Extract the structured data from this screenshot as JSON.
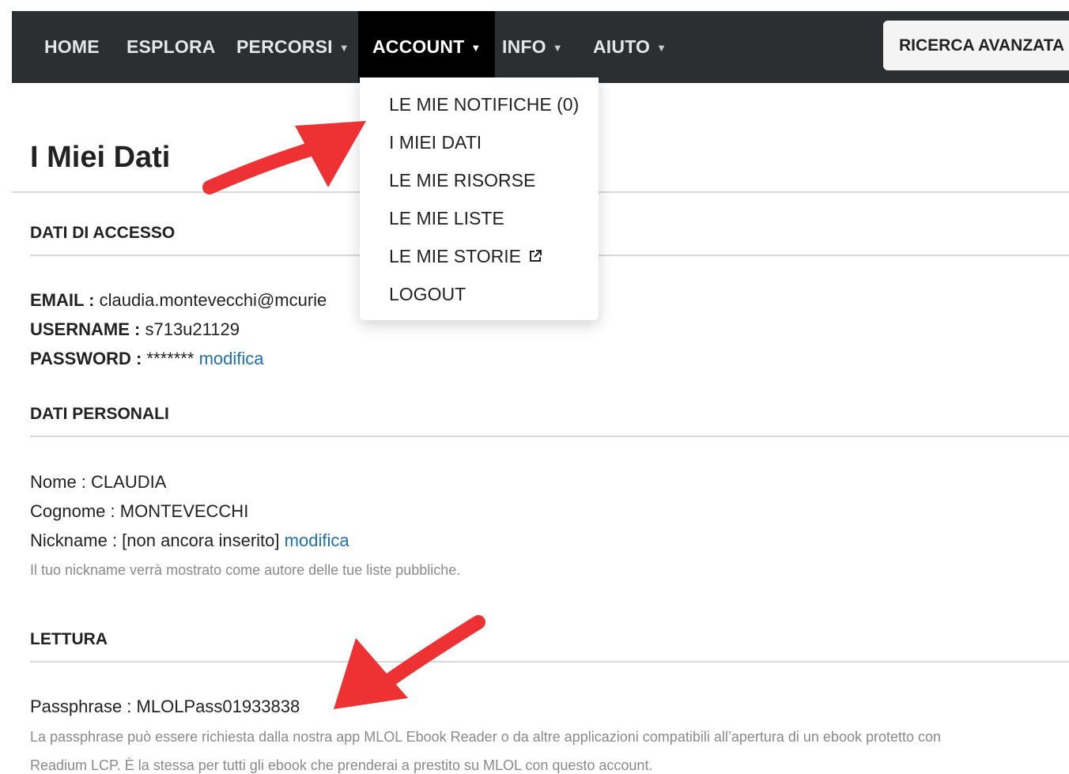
{
  "nav": {
    "home": "HOME",
    "esplora": "ESPLORA",
    "percorsi": "PERCORSI",
    "account": "ACCOUNT",
    "info": "INFO",
    "aiuto": "AIUTO",
    "advanced_search": "RICERCA AVANZATA"
  },
  "account_menu": {
    "items": [
      {
        "label": "LE MIE NOTIFICHE (0)"
      },
      {
        "label": "I MIEI DATI"
      },
      {
        "label": "LE MIE RISORSE"
      },
      {
        "label": "LE MIE LISTE"
      },
      {
        "label": "LE MIE STORIE"
      },
      {
        "label": "LOGOUT"
      }
    ]
  },
  "page": {
    "title": "I Miei Dati"
  },
  "access": {
    "section_title": "DATI DI ACCESSO",
    "email_label": "EMAIL :",
    "email_value": "claudia.montevecchi@mcurie",
    "username_label": "USERNAME :",
    "username_value": "s713u21129",
    "password_label": "PASSWORD :",
    "password_value": "*******",
    "password_edit": "modifica"
  },
  "personal": {
    "section_title": "DATI PERSONALI",
    "nome_label": "Nome :",
    "nome_value": "CLAUDIA",
    "cognome_label": "Cognome :",
    "cognome_value": "MONTEVECCHI",
    "nickname_label": "Nickname :",
    "nickname_value": "[non ancora inserito]",
    "nickname_edit": "modifica",
    "nickname_help": "Il tuo nickname verrà mostrato come autore delle tue liste pubbliche."
  },
  "reading": {
    "section_title": "LETTURA",
    "passphrase_label": "Passphrase :",
    "passphrase_value": "MLOLPass01933838",
    "help_line1": "La passphrase può essere richiesta dalla nostra app MLOL Ebook Reader o da altre applicazioni compatibili all’apertura di un ebook protetto con",
    "help_line2": "Readium LCP. È la stessa per tutti gli ebook che prenderai a prestito su MLOL con questo account."
  },
  "colors": {
    "navbar": "#2b2f31",
    "active_tab": "#000000",
    "link": "#1f6fb2",
    "annotation_arrow": "#ee3234"
  },
  "icons": {
    "dropdown_caret": "caret-down-icon",
    "external": "external-link-icon",
    "annotation": "red-arrow-icon"
  }
}
